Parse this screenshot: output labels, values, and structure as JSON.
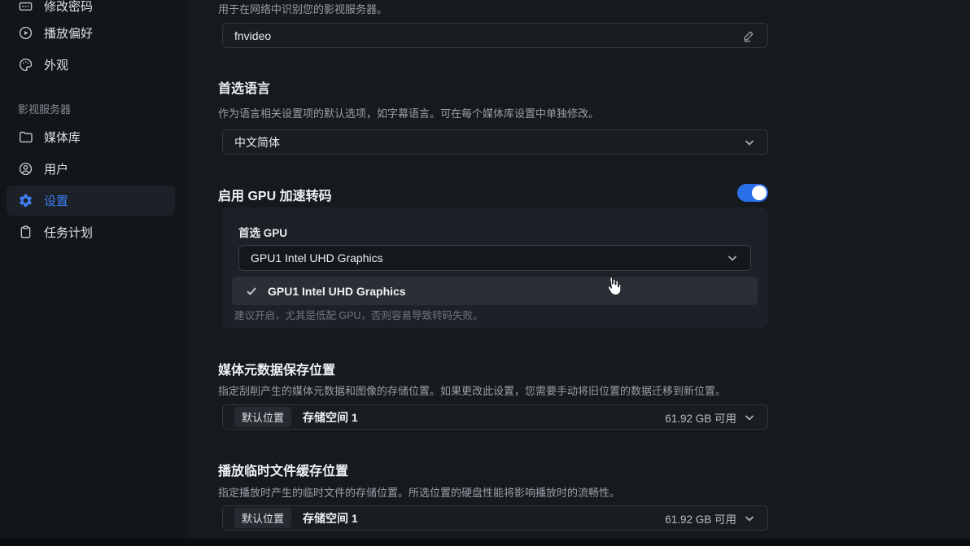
{
  "sidebar": {
    "group_label": "影视服务器",
    "items": [
      {
        "label": "修改密码",
        "icon": "password-icon",
        "active": false
      },
      {
        "label": "播放偏好",
        "icon": "play-circle-icon",
        "active": false
      },
      {
        "label": "外观",
        "icon": "palette-icon",
        "active": false
      },
      {
        "label": "媒体库",
        "icon": "folder-icon",
        "active": false
      },
      {
        "label": "用户",
        "icon": "user-icon",
        "active": false
      },
      {
        "label": "设置",
        "icon": "gear-icon",
        "active": true
      },
      {
        "label": "任务计划",
        "icon": "clipboard-icon",
        "active": false
      }
    ]
  },
  "server_name": {
    "description": "用于在网络中识别您的影视服务器。",
    "value": "fnvideo",
    "edit_icon": "pencil-icon"
  },
  "language": {
    "heading": "首选语言",
    "description": "作为语言相关设置项的默认选项，如字幕语言。可在每个媒体库设置中单独修改。",
    "selected": "中文简体"
  },
  "gpu": {
    "heading": "启用 GPU 加速转码",
    "toggle_state": "on",
    "preferred_label": "首选 GPU",
    "selected": "GPU1 Intel UHD Graphics",
    "menu_option": "GPU1 Intel UHD Graphics",
    "hint": "建议开启，尤其是低配 GPU，否则容易导致转码失败。"
  },
  "metadata_location": {
    "heading": "媒体元数据保存位置",
    "description": "指定刮削产生的媒体元数据和图像的存储位置。如果更改此设置，您需要手动将旧位置的数据迁移到新位置。",
    "badge": "默认位置",
    "value": "存储空间 1",
    "free_space": "61.92 GB 可用"
  },
  "cache_location": {
    "heading": "播放临时文件缓存位置",
    "description": "指定播放时产生的临时文件的存储位置。所选位置的硬盘性能将影响播放时的流畅性。",
    "badge": "默认位置",
    "value": "存储空间 1",
    "free_space": "61.92 GB 可用"
  },
  "colors": {
    "accent_blue": "#3f7ef6",
    "toggle_blue": "#2a6ee8",
    "page_bg": "#16191d",
    "sidebar_bg": "#121519",
    "panel_bg": "#1d2127",
    "menu_highlight": "#2a2f36"
  }
}
